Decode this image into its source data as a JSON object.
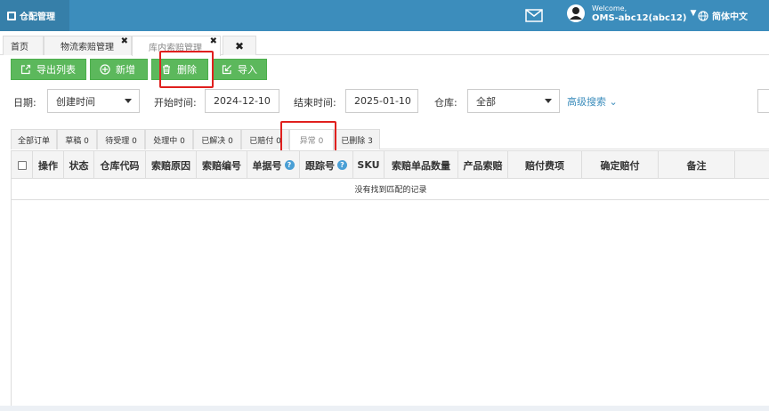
{
  "header": {
    "brand": "仓配管理",
    "welcome": "Welcome,",
    "username": "OMS-abc12(abc12)",
    "language": "简体中文"
  },
  "page_tabs": [
    {
      "label": "首页"
    },
    {
      "label": "物流索赔管理"
    },
    {
      "label": "库内索赔管理"
    }
  ],
  "toolbar": {
    "export": "导出列表",
    "add": "新增",
    "delete": "删除",
    "import": "导入"
  },
  "filters": {
    "date_label": "日期:",
    "date_type": "创建时间",
    "start_label": "开始时间:",
    "start_value": "2024-12-10",
    "end_label": "结束时间:",
    "end_value": "2025-01-10",
    "warehouse_label": "仓库:",
    "warehouse_value": "全部",
    "advanced": "高级搜索"
  },
  "status_tabs": [
    {
      "label": "全部订单"
    },
    {
      "label": "草稿 0"
    },
    {
      "label": "待受理 0"
    },
    {
      "label": "处理中 0"
    },
    {
      "label": "已解决 0"
    },
    {
      "label": "已赔付 0"
    },
    {
      "label": "异常 0"
    },
    {
      "label": "已删除 3"
    }
  ],
  "table": {
    "columns": [
      "操作",
      "状态",
      "仓库代码",
      "索赔原因",
      "索赔编号",
      "单据号",
      "跟踪号",
      "SKU",
      "索赔单品数量",
      "产品索赔",
      "赔付费项",
      "确定赔付",
      "备注"
    ],
    "empty_text": "没有找到匹配的记录"
  },
  "colors": {
    "topbar": "#3c8dbc",
    "button": "#5cb85c",
    "highlight": "#e0201e"
  }
}
